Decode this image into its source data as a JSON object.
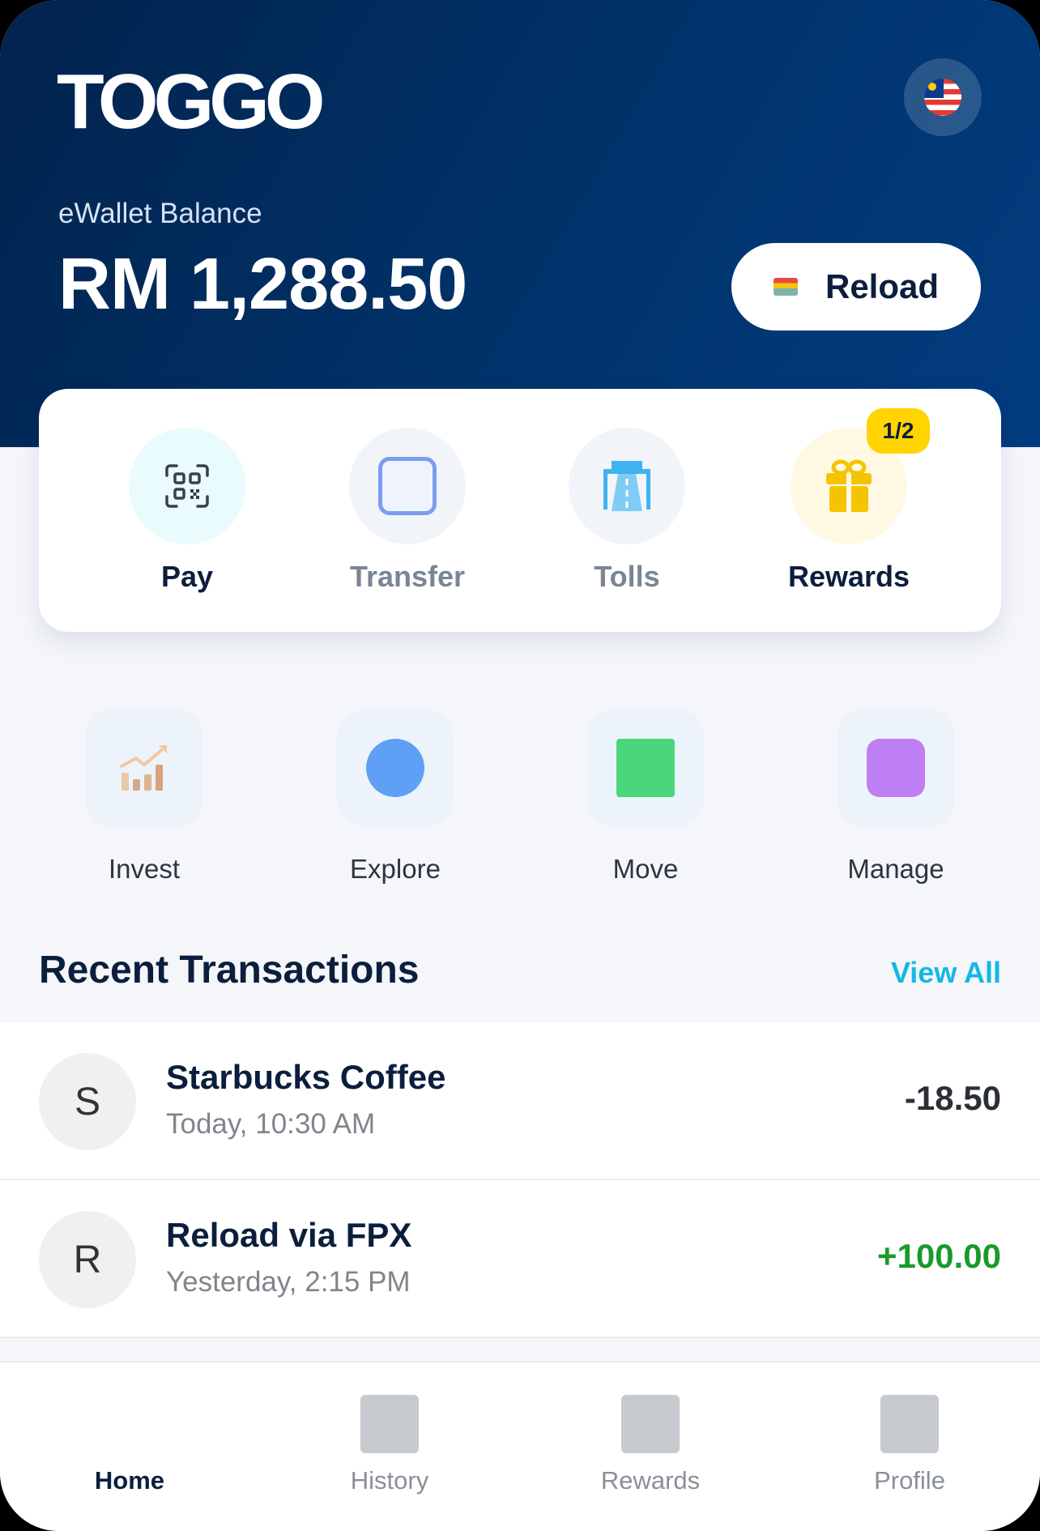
{
  "header": {
    "logo_text": "TOGGO",
    "balance_label": "eWallet Balance",
    "balance_amount": "RM 1,288.50",
    "reload_label": "Reload",
    "language_flag": "malaysia-flag-icon"
  },
  "quick_actions": [
    {
      "label": "Pay",
      "icon": "qr-code-icon",
      "color": "#0c1e3d"
    },
    {
      "label": "Transfer",
      "icon": "transfer-icon",
      "color": "#7a8596"
    },
    {
      "label": "Tolls",
      "icon": "toll-road-icon",
      "color": "#7a8596"
    },
    {
      "label": "Rewards",
      "icon": "gift-icon",
      "color": "#0c1e3d",
      "badge": "1/2"
    }
  ],
  "services": [
    {
      "label": "Invest",
      "icon": "chart-growth-icon"
    },
    {
      "label": "Explore",
      "icon": "explore-icon"
    },
    {
      "label": "Move",
      "icon": "move-icon"
    },
    {
      "label": "Manage",
      "icon": "manage-icon"
    }
  ],
  "transactions": {
    "title": "Recent Transactions",
    "view_all": "View All",
    "items": [
      {
        "initial": "S",
        "name": "Starbucks Coffee",
        "time": "Today, 10:30 AM",
        "amount": "-18.50",
        "amount_color": "#2b2f36"
      },
      {
        "initial": "R",
        "name": "Reload via FPX",
        "time": "Yesterday, 2:15 PM",
        "amount": "+100.00",
        "amount_color": "#1a9a2a"
      }
    ]
  },
  "nav": {
    "items": [
      {
        "label": "Home",
        "active": true
      },
      {
        "label": "History",
        "active": false
      },
      {
        "label": "Rewards",
        "active": false
      },
      {
        "label": "Profile",
        "active": false
      }
    ]
  },
  "colors": {
    "header_start": "#02234d",
    "header_end": "#023c80",
    "accent": "#14b8e6",
    "badge": "#ffd400"
  }
}
